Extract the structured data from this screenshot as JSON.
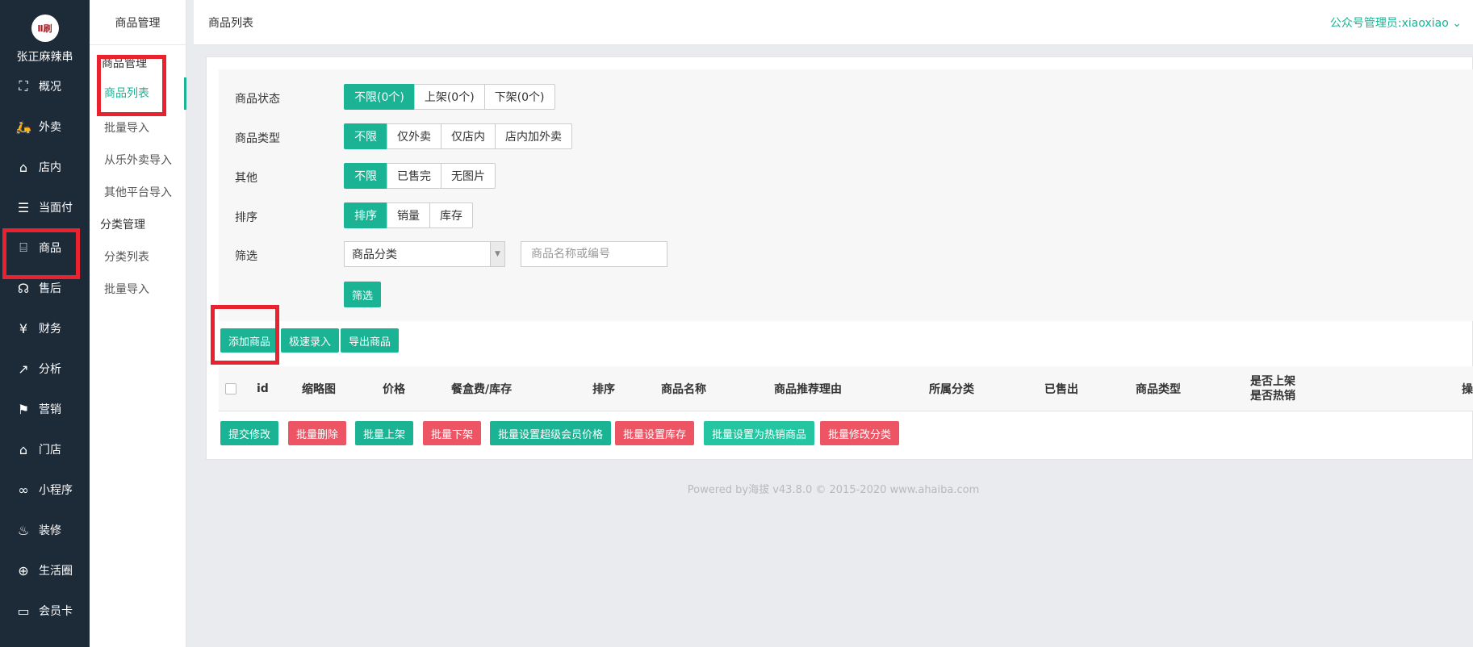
{
  "brand": {
    "logo_text": "Ⅱ刷",
    "name": "张正麻辣串"
  },
  "left_nav": [
    {
      "label": "概况",
      "icon": "dashboard-icon"
    },
    {
      "label": "外卖",
      "icon": "scooter-icon"
    },
    {
      "label": "店内",
      "icon": "shop-icon"
    },
    {
      "label": "当面付",
      "icon": "list-icon"
    },
    {
      "label": "商品",
      "icon": "bag-icon"
    },
    {
      "label": "售后",
      "icon": "headset-icon"
    },
    {
      "label": "财务",
      "icon": "yen-icon"
    },
    {
      "label": "分析",
      "icon": "analytics-icon"
    },
    {
      "label": "营销",
      "icon": "flag-icon"
    },
    {
      "label": "门店",
      "icon": "store-icon"
    },
    {
      "label": "小程序",
      "icon": "link-icon"
    },
    {
      "label": "装修",
      "icon": "flame-icon"
    },
    {
      "label": "生活圈",
      "icon": "globe-icon"
    },
    {
      "label": "会员卡",
      "icon": "card-icon"
    }
  ],
  "sub_nav": {
    "header": "商品管理",
    "items": [
      {
        "label": "商品管理",
        "type": "group"
      },
      {
        "label": "商品列表",
        "type": "active"
      },
      {
        "label": "批量导入",
        "type": "item"
      },
      {
        "label": "从乐外卖导入",
        "type": "item"
      },
      {
        "label": "其他平台导入",
        "type": "item"
      },
      {
        "label": "分类管理",
        "type": "group"
      },
      {
        "label": "分类列表",
        "type": "item"
      },
      {
        "label": "批量导入",
        "type": "item"
      }
    ]
  },
  "header": {
    "title": "商品列表",
    "admin": "公众号管理员:xiaoxiao ⌄"
  },
  "filters": {
    "status": {
      "label": "商品状态",
      "options": [
        "不限(0个)",
        "上架(0个)",
        "下架(0个)"
      ],
      "selected": 0
    },
    "type": {
      "label": "商品类型",
      "options": [
        "不限",
        "仅外卖",
        "仅店内",
        "店内加外卖"
      ],
      "selected": 0
    },
    "other": {
      "label": "其他",
      "options": [
        "不限",
        "已售完",
        "无图片"
      ],
      "selected": 0
    },
    "sort": {
      "label": "排序",
      "options": [
        "排序",
        "销量",
        "库存"
      ],
      "selected": 0
    },
    "filter": {
      "label": "筛选",
      "category_select": "商品分类",
      "name_placeholder": "商品名称或编号",
      "submit": "筛选"
    }
  },
  "actions": {
    "add": "添加商品",
    "quick": "极速录入",
    "export": "导出商品"
  },
  "table": {
    "columns": [
      "id",
      "缩略图",
      "价格",
      "餐盒费/库存",
      "排序",
      "商品名称",
      "商品推荐理由",
      "所属分类",
      "已售出",
      "商品类型"
    ],
    "col_two_line": [
      "是否上架",
      "是否热销"
    ],
    "col_last": "操"
  },
  "batch": {
    "submit": "提交修改",
    "delete": "批量删除",
    "on_shelf": "批量上架",
    "off_shelf": "批量下架",
    "vip_price": "批量设置超级会员价格",
    "stock": "批量设置库存",
    "hot": "批量设置为热销商品",
    "category": "批量修改分类"
  },
  "footer": "Powered by海拔 v43.8.0 © 2015-2020 www.ahaiba.com",
  "colors": {
    "accent": "#1ab394",
    "danger": "#ed5565",
    "nav_bg": "#1d2a38",
    "highlight": "#e8222e"
  }
}
